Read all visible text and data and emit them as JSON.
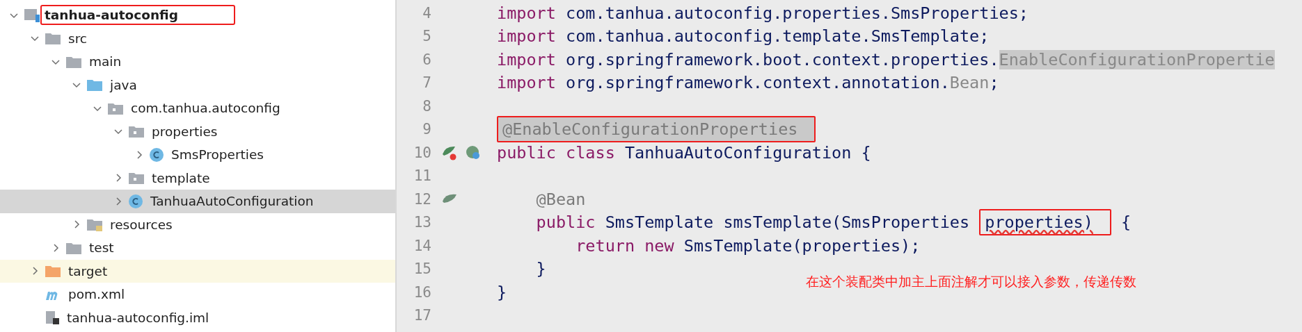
{
  "project_tree": {
    "items": [
      {
        "label": "tanhua-autoconfig",
        "kind": "module",
        "expanded": true,
        "selected": false,
        "boxed": true,
        "children": [
          {
            "label": "src",
            "kind": "folder",
            "expanded": true,
            "selected": false,
            "children": [
              {
                "label": "main",
                "kind": "folder",
                "expanded": true,
                "selected": false,
                "children": [
                  {
                    "label": "java",
                    "kind": "source-folder",
                    "expanded": true,
                    "selected": false,
                    "children": [
                      {
                        "label": "com.tanhua.autoconfig",
                        "kind": "package",
                        "expanded": true,
                        "selected": false,
                        "children": [
                          {
                            "label": "properties",
                            "kind": "package",
                            "expanded": true,
                            "selected": false,
                            "children": [
                              {
                                "label": "SmsProperties",
                                "kind": "class",
                                "expanded": false,
                                "selected": false
                              }
                            ]
                          },
                          {
                            "label": "template",
                            "kind": "package",
                            "expanded": false,
                            "selected": false
                          },
                          {
                            "label": "TanhuaAutoConfiguration",
                            "kind": "class",
                            "expanded": false,
                            "selected": true
                          }
                        ]
                      }
                    ]
                  },
                  {
                    "label": "resources",
                    "kind": "resources-folder",
                    "expanded": false,
                    "selected": false
                  }
                ]
              },
              {
                "label": "test",
                "kind": "folder",
                "expanded": false,
                "selected": false
              }
            ]
          },
          {
            "label": "target",
            "kind": "excluded-folder",
            "expanded": false,
            "selected": false
          },
          {
            "label": "pom.xml",
            "kind": "maven"
          },
          {
            "label": "tanhua-autoconfig.iml",
            "kind": "iml"
          }
        ]
      }
    ]
  },
  "editor": {
    "lines": [
      {
        "number": "4",
        "tokens": [
          {
            "text": "import",
            "kind": "keyword"
          },
          {
            "text": " com.tanhua.autoconfig.properties.SmsProperties;",
            "kind": "plain"
          }
        ]
      },
      {
        "number": "5",
        "tokens": [
          {
            "text": "import",
            "kind": "keyword"
          },
          {
            "text": " com.tanhua.autoconfig.template.SmsTemplate;",
            "kind": "plain"
          }
        ]
      },
      {
        "number": "6",
        "tokens": [
          {
            "text": "import",
            "kind": "keyword"
          },
          {
            "text": " org.springframework.boot.context.properties.",
            "kind": "plain"
          },
          {
            "text": "EnableConfigurationPropertie",
            "kind": "unused-highlighted"
          }
        ]
      },
      {
        "number": "7",
        "tokens": [
          {
            "text": "import",
            "kind": "keyword"
          },
          {
            "text": " org.springframework.context.annotation.",
            "kind": "plain"
          },
          {
            "text": "Bean",
            "kind": "unused"
          },
          {
            "text": ";",
            "kind": "plain"
          }
        ]
      },
      {
        "number": "8"
      },
      {
        "number": "9",
        "tokens": [
          {
            "text": "@EnableConfigurationProperties",
            "kind": "annotation-highlighted",
            "boxed": true
          }
        ]
      },
      {
        "number": "10",
        "markers": [
          {
            "kind": "bean-run"
          },
          {
            "kind": "spring"
          }
        ],
        "tokens": [
          {
            "text": "public class",
            "kind": "keyword"
          },
          {
            "text": " TanhuaAutoConfiguration {",
            "kind": "plain"
          }
        ]
      },
      {
        "number": "11"
      },
      {
        "number": "12",
        "markers": [
          {
            "kind": "bean"
          }
        ],
        "tokens": [
          {
            "text": "    @Bean",
            "kind": "annotation"
          }
        ]
      },
      {
        "number": "13",
        "tokens": [
          {
            "text": "    public",
            "kind": "keyword"
          },
          {
            "text": " SmsTemplate smsTemplate(SmsProperties ",
            "kind": "plain"
          },
          {
            "text": "properties)",
            "kind": "plain",
            "boxed": true,
            "error": true
          },
          {
            "text": " {",
            "kind": "plain"
          }
        ]
      },
      {
        "number": "14",
        "tokens": [
          {
            "text": "        return new",
            "kind": "keyword"
          },
          {
            "text": " SmsTemplate(properties);",
            "kind": "plain"
          }
        ]
      },
      {
        "number": "15",
        "tokens": [
          {
            "text": "    }",
            "kind": "plain"
          }
        ]
      },
      {
        "number": "16",
        "tokens": [
          {
            "text": "}",
            "kind": "plain"
          }
        ]
      },
      {
        "number": "17"
      }
    ]
  },
  "note": {
    "text": "在这个装配类中加主上面注解才可以接入参数，传递传数"
  }
}
